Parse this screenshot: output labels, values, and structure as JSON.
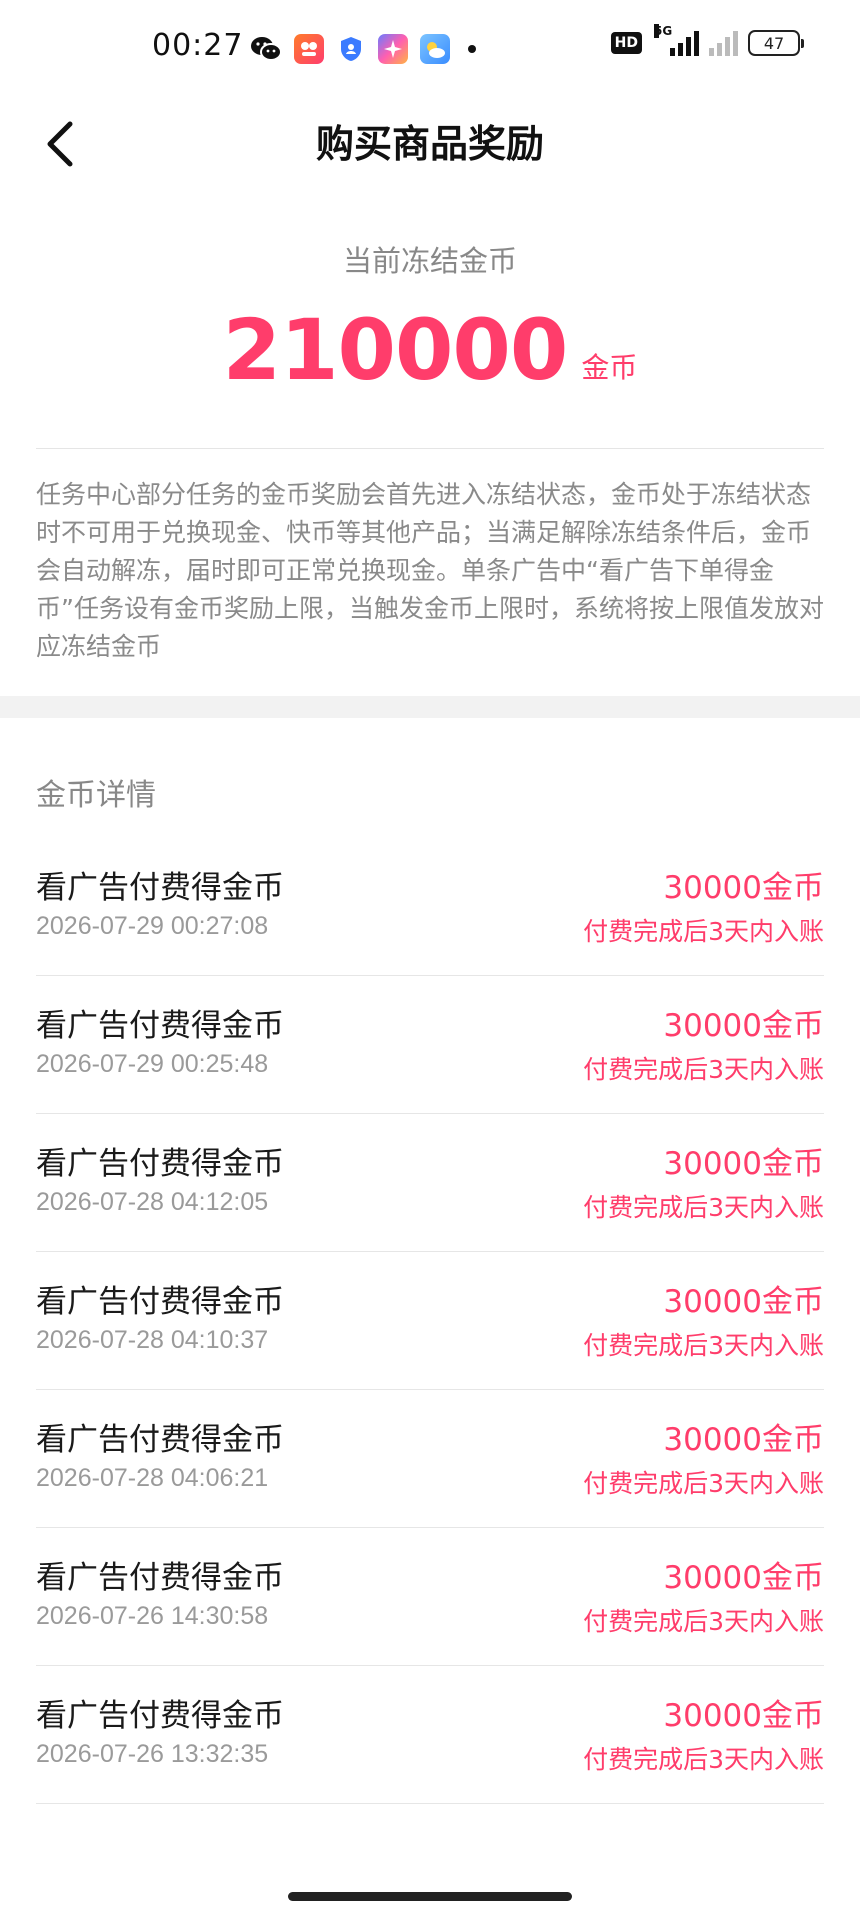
{
  "status_bar": {
    "time": "00:27",
    "network_label": "5G",
    "battery_level": "47"
  },
  "header": {
    "title": "购买商品奖励"
  },
  "summary": {
    "label": "当前冻结金币",
    "amount": "210000",
    "unit": "金币"
  },
  "description": "任务中心部分任务的金币奖励会首先进入冻结状态，金币处于冻结状态时不可用于兑换现金、快币等其他产品；当满足解除冻结条件后，金币会自动解冻，届时即可正常兑换现金。单条广告中“看广告下单得金币”任务设有金币奖励上限，当触发金币上限时，系统将按上限值发放对应冻结金币",
  "details": {
    "title": "金币详情",
    "items": [
      {
        "name": "看广告付费得金币",
        "time": "2026-07-29 00:27:08",
        "amount": "30000金币",
        "note": "付费完成后3天内入账"
      },
      {
        "name": "看广告付费得金币",
        "time": "2026-07-29 00:25:48",
        "amount": "30000金币",
        "note": "付费完成后3天内入账"
      },
      {
        "name": "看广告付费得金币",
        "time": "2026-07-28 04:12:05",
        "amount": "30000金币",
        "note": "付费完成后3天内入账"
      },
      {
        "name": "看广告付费得金币",
        "time": "2026-07-28 04:10:37",
        "amount": "30000金币",
        "note": "付费完成后3天内入账"
      },
      {
        "name": "看广告付费得金币",
        "time": "2026-07-28 04:06:21",
        "amount": "30000金币",
        "note": "付费完成后3天内入账"
      },
      {
        "name": "看广告付费得金币",
        "time": "2026-07-26 14:30:58",
        "amount": "30000金币",
        "note": "付费完成后3天内入账"
      },
      {
        "name": "看广告付费得金币",
        "time": "2026-07-26 13:32:35",
        "amount": "30000金币",
        "note": "付费完成后3天内入账"
      }
    ]
  },
  "colors": {
    "accent": "#ff3d6b",
    "muted_text": "#8a8a8a",
    "divider": "#e6e6e6"
  },
  "icons": [
    "wechat-icon",
    "taobao-icon",
    "shield-icon",
    "star-app-icon",
    "weather-icon",
    "back-arrow-icon"
  ]
}
